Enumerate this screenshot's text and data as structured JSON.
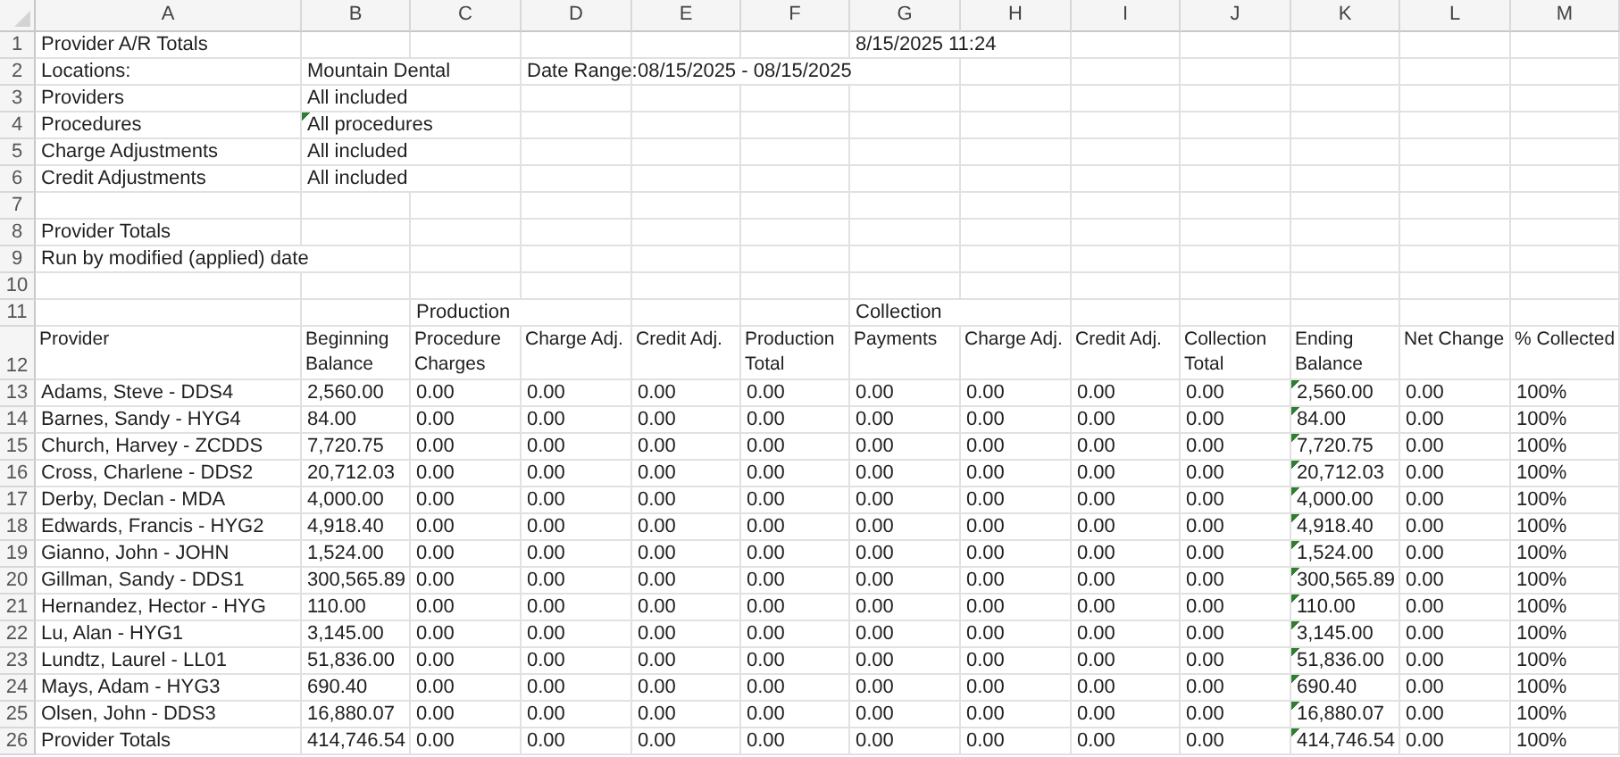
{
  "columns": [
    "A",
    "B",
    "C",
    "D",
    "E",
    "F",
    "G",
    "H",
    "I",
    "J",
    "K",
    "L",
    "M"
  ],
  "rows": [
    {
      "number": "1",
      "wrapped": false,
      "cells": [
        {
          "text": "Provider A/R Totals",
          "flagged": false
        },
        null,
        null,
        null,
        null,
        null,
        {
          "text": "8/15/2025 11:24",
          "flagged": false
        },
        null,
        null,
        null,
        null,
        null,
        null
      ]
    },
    {
      "number": "2",
      "wrapped": false,
      "cells": [
        {
          "text": "Locations:",
          "flagged": false
        },
        {
          "text": "Mountain Dental",
          "flagged": false
        },
        null,
        {
          "text": "Date Range:",
          "flagged": false
        },
        {
          "text": "08/15/2025 - 08/15/2025",
          "flagged": false
        },
        null,
        null,
        null,
        null,
        null,
        null,
        null,
        null
      ]
    },
    {
      "number": "3",
      "wrapped": false,
      "cells": [
        {
          "text": "Providers",
          "flagged": false
        },
        {
          "text": "All included",
          "flagged": false
        },
        null,
        null,
        null,
        null,
        null,
        null,
        null,
        null,
        null,
        null,
        null
      ]
    },
    {
      "number": "4",
      "wrapped": false,
      "cells": [
        {
          "text": "Procedures",
          "flagged": false
        },
        {
          "text": "All procedures",
          "flagged": true
        },
        null,
        null,
        null,
        null,
        null,
        null,
        null,
        null,
        null,
        null,
        null
      ]
    },
    {
      "number": "5",
      "wrapped": false,
      "cells": [
        {
          "text": "Charge Adjustments",
          "flagged": false
        },
        {
          "text": "All included",
          "flagged": false
        },
        null,
        null,
        null,
        null,
        null,
        null,
        null,
        null,
        null,
        null,
        null
      ]
    },
    {
      "number": "6",
      "wrapped": false,
      "cells": [
        {
          "text": "Credit Adjustments",
          "flagged": false
        },
        {
          "text": "All included",
          "flagged": false
        },
        null,
        null,
        null,
        null,
        null,
        null,
        null,
        null,
        null,
        null,
        null
      ]
    },
    {
      "number": "7",
      "wrapped": false,
      "cells": [
        null,
        null,
        null,
        null,
        null,
        null,
        null,
        null,
        null,
        null,
        null,
        null,
        null
      ]
    },
    {
      "number": "8",
      "wrapped": false,
      "cells": [
        {
          "text": "Provider Totals",
          "flagged": false
        },
        null,
        null,
        null,
        null,
        null,
        null,
        null,
        null,
        null,
        null,
        null,
        null
      ]
    },
    {
      "number": "9",
      "wrapped": false,
      "cells": [
        {
          "text": "Run by modified (applied) date",
          "flagged": false
        },
        null,
        null,
        null,
        null,
        null,
        null,
        null,
        null,
        null,
        null,
        null,
        null
      ]
    },
    {
      "number": "10",
      "wrapped": false,
      "cells": [
        null,
        null,
        null,
        null,
        null,
        null,
        null,
        null,
        null,
        null,
        null,
        null,
        null
      ]
    },
    {
      "number": "11",
      "wrapped": false,
      "cells": [
        null,
        null,
        {
          "text": "Production",
          "flagged": false
        },
        null,
        null,
        null,
        {
          "text": "Collection",
          "flagged": false
        },
        null,
        null,
        null,
        null,
        null,
        null
      ]
    },
    {
      "number": "12",
      "wrapped": true,
      "cells": [
        {
          "text": "Provider",
          "flagged": false
        },
        {
          "text": "Beginning Balance",
          "flagged": false
        },
        {
          "text": "Procedure Charges",
          "flagged": false
        },
        {
          "text": "Charge Adj.",
          "flagged": false
        },
        {
          "text": "Credit Adj.",
          "flagged": false
        },
        {
          "text": "Production Total",
          "flagged": false
        },
        {
          "text": "Payments",
          "flagged": false
        },
        {
          "text": "Charge Adj.",
          "flagged": false
        },
        {
          "text": "Credit Adj.",
          "flagged": false
        },
        {
          "text": "Collection Total",
          "flagged": false
        },
        {
          "text": "Ending Balance",
          "flagged": false
        },
        {
          "text": "Net Change",
          "flagged": false
        },
        {
          "text": "% Collected",
          "flagged": false
        }
      ]
    },
    {
      "number": "13",
      "wrapped": false,
      "cells": [
        {
          "text": "Adams, Steve - DDS4",
          "flagged": false
        },
        {
          "text": "2,560.00",
          "flagged": false
        },
        {
          "text": "0.00",
          "flagged": false
        },
        {
          "text": "0.00",
          "flagged": false
        },
        {
          "text": "0.00",
          "flagged": false
        },
        {
          "text": "0.00",
          "flagged": false
        },
        {
          "text": "0.00",
          "flagged": false
        },
        {
          "text": "0.00",
          "flagged": false
        },
        {
          "text": "0.00",
          "flagged": false
        },
        {
          "text": "0.00",
          "flagged": false
        },
        {
          "text": "2,560.00",
          "flagged": true
        },
        {
          "text": "0.00",
          "flagged": false
        },
        {
          "text": "100%",
          "flagged": false
        }
      ]
    },
    {
      "number": "14",
      "wrapped": false,
      "cells": [
        {
          "text": "Barnes, Sandy - HYG4",
          "flagged": false
        },
        {
          "text": "84.00",
          "flagged": false
        },
        {
          "text": "0.00",
          "flagged": false
        },
        {
          "text": "0.00",
          "flagged": false
        },
        {
          "text": "0.00",
          "flagged": false
        },
        {
          "text": "0.00",
          "flagged": false
        },
        {
          "text": "0.00",
          "flagged": false
        },
        {
          "text": "0.00",
          "flagged": false
        },
        {
          "text": "0.00",
          "flagged": false
        },
        {
          "text": "0.00",
          "flagged": false
        },
        {
          "text": "84.00",
          "flagged": true
        },
        {
          "text": "0.00",
          "flagged": false
        },
        {
          "text": "100%",
          "flagged": false
        }
      ]
    },
    {
      "number": "15",
      "wrapped": false,
      "cells": [
        {
          "text": "Church, Harvey - ZCDDS",
          "flagged": false
        },
        {
          "text": "7,720.75",
          "flagged": false
        },
        {
          "text": "0.00",
          "flagged": false
        },
        {
          "text": "0.00",
          "flagged": false
        },
        {
          "text": "0.00",
          "flagged": false
        },
        {
          "text": "0.00",
          "flagged": false
        },
        {
          "text": "0.00",
          "flagged": false
        },
        {
          "text": "0.00",
          "flagged": false
        },
        {
          "text": "0.00",
          "flagged": false
        },
        {
          "text": "0.00",
          "flagged": false
        },
        {
          "text": "7,720.75",
          "flagged": true
        },
        {
          "text": "0.00",
          "flagged": false
        },
        {
          "text": "100%",
          "flagged": false
        }
      ]
    },
    {
      "number": "16",
      "wrapped": false,
      "cells": [
        {
          "text": "Cross, Charlene - DDS2",
          "flagged": false
        },
        {
          "text": "20,712.03",
          "flagged": false
        },
        {
          "text": "0.00",
          "flagged": false
        },
        {
          "text": "0.00",
          "flagged": false
        },
        {
          "text": "0.00",
          "flagged": false
        },
        {
          "text": "0.00",
          "flagged": false
        },
        {
          "text": "0.00",
          "flagged": false
        },
        {
          "text": "0.00",
          "flagged": false
        },
        {
          "text": "0.00",
          "flagged": false
        },
        {
          "text": "0.00",
          "flagged": false
        },
        {
          "text": "20,712.03",
          "flagged": true
        },
        {
          "text": "0.00",
          "flagged": false
        },
        {
          "text": "100%",
          "flagged": false
        }
      ]
    },
    {
      "number": "17",
      "wrapped": false,
      "cells": [
        {
          "text": "Derby, Declan - MDA",
          "flagged": false
        },
        {
          "text": "4,000.00",
          "flagged": false
        },
        {
          "text": "0.00",
          "flagged": false
        },
        {
          "text": "0.00",
          "flagged": false
        },
        {
          "text": "0.00",
          "flagged": false
        },
        {
          "text": "0.00",
          "flagged": false
        },
        {
          "text": "0.00",
          "flagged": false
        },
        {
          "text": "0.00",
          "flagged": false
        },
        {
          "text": "0.00",
          "flagged": false
        },
        {
          "text": "0.00",
          "flagged": false
        },
        {
          "text": "4,000.00",
          "flagged": true
        },
        {
          "text": "0.00",
          "flagged": false
        },
        {
          "text": "100%",
          "flagged": false
        }
      ]
    },
    {
      "number": "18",
      "wrapped": false,
      "cells": [
        {
          "text": "Edwards, Francis - HYG2",
          "flagged": false
        },
        {
          "text": "4,918.40",
          "flagged": false
        },
        {
          "text": "0.00",
          "flagged": false
        },
        {
          "text": "0.00",
          "flagged": false
        },
        {
          "text": "0.00",
          "flagged": false
        },
        {
          "text": "0.00",
          "flagged": false
        },
        {
          "text": "0.00",
          "flagged": false
        },
        {
          "text": "0.00",
          "flagged": false
        },
        {
          "text": "0.00",
          "flagged": false
        },
        {
          "text": "0.00",
          "flagged": false
        },
        {
          "text": "4,918.40",
          "flagged": true
        },
        {
          "text": "0.00",
          "flagged": false
        },
        {
          "text": "100%",
          "flagged": false
        }
      ]
    },
    {
      "number": "19",
      "wrapped": false,
      "cells": [
        {
          "text": "Gianno, John - JOHN",
          "flagged": false
        },
        {
          "text": "1,524.00",
          "flagged": false
        },
        {
          "text": "0.00",
          "flagged": false
        },
        {
          "text": "0.00",
          "flagged": false
        },
        {
          "text": "0.00",
          "flagged": false
        },
        {
          "text": "0.00",
          "flagged": false
        },
        {
          "text": "0.00",
          "flagged": false
        },
        {
          "text": "0.00",
          "flagged": false
        },
        {
          "text": "0.00",
          "flagged": false
        },
        {
          "text": "0.00",
          "flagged": false
        },
        {
          "text": "1,524.00",
          "flagged": true
        },
        {
          "text": "0.00",
          "flagged": false
        },
        {
          "text": "100%",
          "flagged": false
        }
      ]
    },
    {
      "number": "20",
      "wrapped": false,
      "cells": [
        {
          "text": "Gillman, Sandy - DDS1",
          "flagged": false
        },
        {
          "text": "300,565.89",
          "flagged": false
        },
        {
          "text": "0.00",
          "flagged": false
        },
        {
          "text": "0.00",
          "flagged": false
        },
        {
          "text": "0.00",
          "flagged": false
        },
        {
          "text": "0.00",
          "flagged": false
        },
        {
          "text": "0.00",
          "flagged": false
        },
        {
          "text": "0.00",
          "flagged": false
        },
        {
          "text": "0.00",
          "flagged": false
        },
        {
          "text": "0.00",
          "flagged": false
        },
        {
          "text": "300,565.89",
          "flagged": true
        },
        {
          "text": "0.00",
          "flagged": false
        },
        {
          "text": "100%",
          "flagged": false
        }
      ]
    },
    {
      "number": "21",
      "wrapped": false,
      "cells": [
        {
          "text": "Hernandez, Hector - HYG",
          "flagged": false
        },
        {
          "text": "110.00",
          "flagged": false
        },
        {
          "text": "0.00",
          "flagged": false
        },
        {
          "text": "0.00",
          "flagged": false
        },
        {
          "text": "0.00",
          "flagged": false
        },
        {
          "text": "0.00",
          "flagged": false
        },
        {
          "text": "0.00",
          "flagged": false
        },
        {
          "text": "0.00",
          "flagged": false
        },
        {
          "text": "0.00",
          "flagged": false
        },
        {
          "text": "0.00",
          "flagged": false
        },
        {
          "text": "110.00",
          "flagged": true
        },
        {
          "text": "0.00",
          "flagged": false
        },
        {
          "text": "100%",
          "flagged": false
        }
      ]
    },
    {
      "number": "22",
      "wrapped": false,
      "cells": [
        {
          "text": "Lu, Alan - HYG1",
          "flagged": false
        },
        {
          "text": "3,145.00",
          "flagged": false
        },
        {
          "text": "0.00",
          "flagged": false
        },
        {
          "text": "0.00",
          "flagged": false
        },
        {
          "text": "0.00",
          "flagged": false
        },
        {
          "text": "0.00",
          "flagged": false
        },
        {
          "text": "0.00",
          "flagged": false
        },
        {
          "text": "0.00",
          "flagged": false
        },
        {
          "text": "0.00",
          "flagged": false
        },
        {
          "text": "0.00",
          "flagged": false
        },
        {
          "text": "3,145.00",
          "flagged": true
        },
        {
          "text": "0.00",
          "flagged": false
        },
        {
          "text": "100%",
          "flagged": false
        }
      ]
    },
    {
      "number": "23",
      "wrapped": false,
      "cells": [
        {
          "text": "Lundtz, Laurel - LL01",
          "flagged": false
        },
        {
          "text": "51,836.00",
          "flagged": false
        },
        {
          "text": "0.00",
          "flagged": false
        },
        {
          "text": "0.00",
          "flagged": false
        },
        {
          "text": "0.00",
          "flagged": false
        },
        {
          "text": "0.00",
          "flagged": false
        },
        {
          "text": "0.00",
          "flagged": false
        },
        {
          "text": "0.00",
          "flagged": false
        },
        {
          "text": "0.00",
          "flagged": false
        },
        {
          "text": "0.00",
          "flagged": false
        },
        {
          "text": "51,836.00",
          "flagged": true
        },
        {
          "text": "0.00",
          "flagged": false
        },
        {
          "text": "100%",
          "flagged": false
        }
      ]
    },
    {
      "number": "24",
      "wrapped": false,
      "cells": [
        {
          "text": "Mays, Adam - HYG3",
          "flagged": false
        },
        {
          "text": "690.40",
          "flagged": false
        },
        {
          "text": "0.00",
          "flagged": false
        },
        {
          "text": "0.00",
          "flagged": false
        },
        {
          "text": "0.00",
          "flagged": false
        },
        {
          "text": "0.00",
          "flagged": false
        },
        {
          "text": "0.00",
          "flagged": false
        },
        {
          "text": "0.00",
          "flagged": false
        },
        {
          "text": "0.00",
          "flagged": false
        },
        {
          "text": "0.00",
          "flagged": false
        },
        {
          "text": "690.40",
          "flagged": true
        },
        {
          "text": "0.00",
          "flagged": false
        },
        {
          "text": "100%",
          "flagged": false
        }
      ]
    },
    {
      "number": "25",
      "wrapped": false,
      "cells": [
        {
          "text": "Olsen, John - DDS3",
          "flagged": false
        },
        {
          "text": "16,880.07",
          "flagged": false
        },
        {
          "text": "0.00",
          "flagged": false
        },
        {
          "text": "0.00",
          "flagged": false
        },
        {
          "text": "0.00",
          "flagged": false
        },
        {
          "text": "0.00",
          "flagged": false
        },
        {
          "text": "0.00",
          "flagged": false
        },
        {
          "text": "0.00",
          "flagged": false
        },
        {
          "text": "0.00",
          "flagged": false
        },
        {
          "text": "0.00",
          "flagged": false
        },
        {
          "text": "16,880.07",
          "flagged": true
        },
        {
          "text": "0.00",
          "flagged": false
        },
        {
          "text": "100%",
          "flagged": false
        }
      ]
    },
    {
      "number": "26",
      "wrapped": false,
      "cells": [
        {
          "text": "Provider Totals",
          "flagged": false
        },
        {
          "text": "414,746.54",
          "flagged": false
        },
        {
          "text": "0.00",
          "flagged": false
        },
        {
          "text": "0.00",
          "flagged": false
        },
        {
          "text": "0.00",
          "flagged": false
        },
        {
          "text": "0.00",
          "flagged": false
        },
        {
          "text": "0.00",
          "flagged": false
        },
        {
          "text": "0.00",
          "flagged": false
        },
        {
          "text": "0.00",
          "flagged": false
        },
        {
          "text": "0.00",
          "flagged": false
        },
        {
          "text": "414,746.54",
          "flagged": true
        },
        {
          "text": "0.00",
          "flagged": false
        },
        {
          "text": "100%",
          "flagged": false
        }
      ]
    }
  ]
}
